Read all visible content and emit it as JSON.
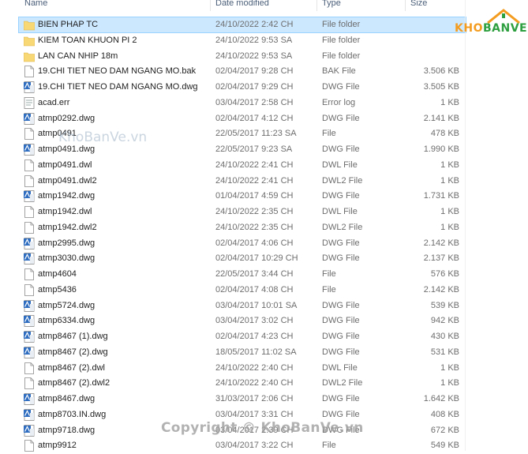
{
  "columns": {
    "name": "Name",
    "date": "Date modified",
    "type": "Type",
    "size": "Size"
  },
  "files": [
    {
      "name": "BIEN PHAP TC",
      "date": "24/10/2022 2:42 CH",
      "type": "File folder",
      "size": "",
      "icon": "folder-icon",
      "selected": true
    },
    {
      "name": "KIEM TOAN KHUON PI 2",
      "date": "24/10/2022 9:53 SA",
      "type": "File folder",
      "size": "",
      "icon": "folder-icon"
    },
    {
      "name": "LAN CAN NHIP 18m",
      "date": "24/10/2022 9:53 SA",
      "type": "File folder",
      "size": "",
      "icon": "folder-icon"
    },
    {
      "name": "19.CHI TIET NEO DAM NGANG MO.bak",
      "date": "02/04/2017 9:28 CH",
      "type": "BAK File",
      "size": "3.506 KB",
      "icon": "file-icon"
    },
    {
      "name": "19.CHI TIET NEO DAM NGANG MO.dwg",
      "date": "02/04/2017 9:29 CH",
      "type": "DWG File",
      "size": "3.505 KB",
      "icon": "dwg-icon"
    },
    {
      "name": "acad.err",
      "date": "03/04/2017 2:58 CH",
      "type": "Error log",
      "size": "1 KB",
      "icon": "log-icon"
    },
    {
      "name": "atmp0292.dwg",
      "date": "02/04/2017 4:12 CH",
      "type": "DWG File",
      "size": "2.141 KB",
      "icon": "dwg-icon"
    },
    {
      "name": "atmp0491",
      "date": "22/05/2017 11:23 SA",
      "type": "File",
      "size": "478 KB",
      "icon": "file-icon"
    },
    {
      "name": "atmp0491.dwg",
      "date": "22/05/2017 9:23 SA",
      "type": "DWG File",
      "size": "1.990 KB",
      "icon": "dwg-icon"
    },
    {
      "name": "atmp0491.dwl",
      "date": "24/10/2022 2:41 CH",
      "type": "DWL File",
      "size": "1 KB",
      "icon": "file-icon"
    },
    {
      "name": "atmp0491.dwl2",
      "date": "24/10/2022 2:41 CH",
      "type": "DWL2 File",
      "size": "1 KB",
      "icon": "file-icon"
    },
    {
      "name": "atmp1942.dwg",
      "date": "01/04/2017 4:59 CH",
      "type": "DWG File",
      "size": "1.731 KB",
      "icon": "dwg-icon"
    },
    {
      "name": "atmp1942.dwl",
      "date": "24/10/2022 2:35 CH",
      "type": "DWL File",
      "size": "1 KB",
      "icon": "file-icon"
    },
    {
      "name": "atmp1942.dwl2",
      "date": "24/10/2022 2:35 CH",
      "type": "DWL2 File",
      "size": "1 KB",
      "icon": "file-icon"
    },
    {
      "name": "atmp2995.dwg",
      "date": "02/04/2017 4:06 CH",
      "type": "DWG File",
      "size": "2.142 KB",
      "icon": "dwg-icon"
    },
    {
      "name": "atmp3030.dwg",
      "date": "02/04/2017 10:29 CH",
      "type": "DWG File",
      "size": "2.137 KB",
      "icon": "dwg-icon"
    },
    {
      "name": "atmp4604",
      "date": "22/05/2017 3:44 CH",
      "type": "File",
      "size": "576 KB",
      "icon": "file-icon"
    },
    {
      "name": "atmp5436",
      "date": "02/04/2017 4:08 CH",
      "type": "File",
      "size": "2.142 KB",
      "icon": "file-icon"
    },
    {
      "name": "atmp5724.dwg",
      "date": "03/04/2017 10:01 SA",
      "type": "DWG File",
      "size": "539 KB",
      "icon": "dwg-icon"
    },
    {
      "name": "atmp6334.dwg",
      "date": "03/04/2017 3:02 CH",
      "type": "DWG File",
      "size": "942 KB",
      "icon": "dwg-icon"
    },
    {
      "name": "atmp8467 (1).dwg",
      "date": "02/04/2017 4:23 CH",
      "type": "DWG File",
      "size": "430 KB",
      "icon": "dwg-icon"
    },
    {
      "name": "atmp8467 (2).dwg",
      "date": "18/05/2017 11:02 SA",
      "type": "DWG File",
      "size": "531 KB",
      "icon": "dwg-icon"
    },
    {
      "name": "atmp8467 (2).dwl",
      "date": "24/10/2022 2:40 CH",
      "type": "DWL File",
      "size": "1 KB",
      "icon": "file-icon"
    },
    {
      "name": "atmp8467 (2).dwl2",
      "date": "24/10/2022 2:40 CH",
      "type": "DWL2 File",
      "size": "1 KB",
      "icon": "file-icon"
    },
    {
      "name": "atmp8467.dwg",
      "date": "31/03/2017 2:06 CH",
      "type": "DWG File",
      "size": "1.642 KB",
      "icon": "dwg-icon"
    },
    {
      "name": "atmp8703.IN.dwg",
      "date": "03/04/2017 3:31 CH",
      "type": "DWG File",
      "size": "408 KB",
      "icon": "dwg-icon"
    },
    {
      "name": "atmp9718.dwg",
      "date": "03/04/2017 2:39 CH",
      "type": "DWG File",
      "size": "672 KB",
      "icon": "dwg-icon"
    },
    {
      "name": "atmp9912",
      "date": "03/04/2017 3:22 CH",
      "type": "File",
      "size": "549 KB",
      "icon": "file-icon"
    }
  ],
  "watermark": {
    "logo_text": "KHOBANVE",
    "inline_text": "KhoBanVe.vn",
    "copyright_text": "Copyright © KhoBanVe.vn"
  },
  "colors": {
    "selected_bg": "#cce8ff",
    "folder": "#f8d775",
    "dwg_blue": "#2e6dbf",
    "logo_orange": "#f39c1f",
    "logo_green": "#2e9f3f"
  }
}
